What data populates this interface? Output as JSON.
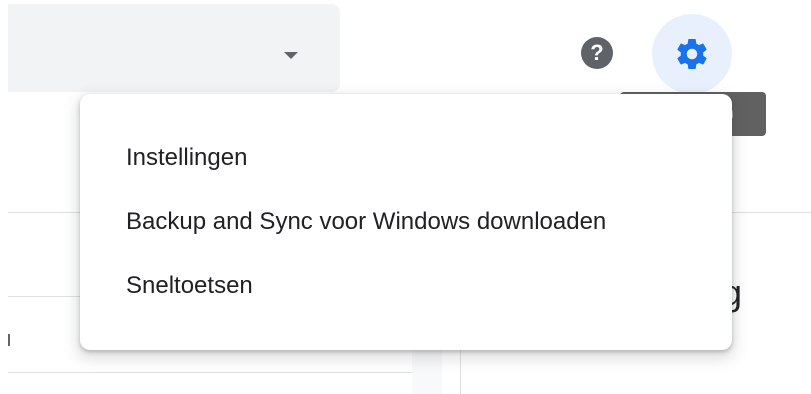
{
  "header": {
    "help_icon": "help-circle-icon",
    "help_glyph": "?",
    "settings_icon": "gear-icon",
    "settings_tooltip": "Instellingen",
    "accent_color": "#1a73e8",
    "settings_bg_color": "#e8f0fe"
  },
  "search": {
    "dropdown_icon": "caret-down-icon"
  },
  "background": {
    "partial_text": "erg"
  },
  "settings_menu": {
    "items": [
      {
        "label": "Instellingen"
      },
      {
        "label": "Backup and Sync voor Windows downloaden"
      },
      {
        "label": "Sneltoetsen"
      }
    ]
  }
}
